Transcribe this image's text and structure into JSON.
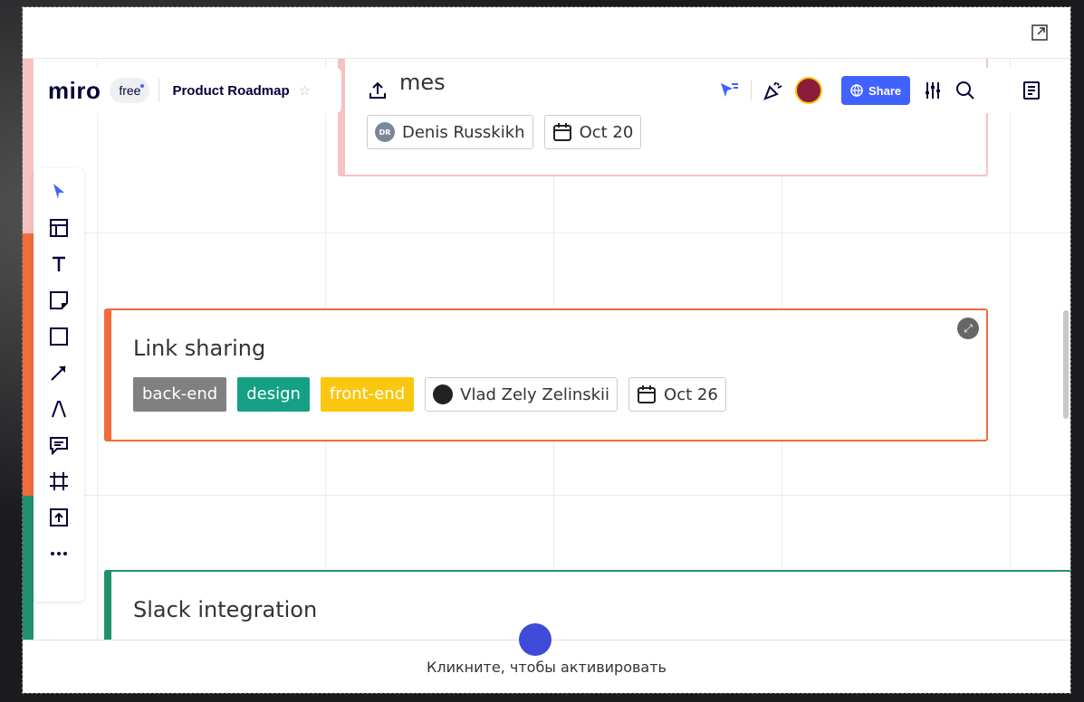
{
  "app": {
    "logo": "miro",
    "plan_badge": "free",
    "board_name": "Product Roadmap",
    "share_label": "Share"
  },
  "cards": [
    {
      "title_partial": "mes",
      "assignee": "Denis Russkikh",
      "assignee_initials": "DR",
      "date": "Oct 20",
      "color": "#f7c2c2"
    },
    {
      "title": "Link sharing",
      "tags": [
        {
          "label": "back-end",
          "color": "#808080"
        },
        {
          "label": "design",
          "color": "#14a085"
        },
        {
          "label": "front-end",
          "color": "#fac710"
        }
      ],
      "assignee": "Vlad Zely Zelinskii",
      "date": "Oct 26",
      "color": "#f26b3a"
    },
    {
      "title": "Slack integration",
      "color": "#21916d"
    }
  ],
  "footer": {
    "activate_text": "Кликните, чтобы активировать"
  },
  "colors": {
    "accent": "#4262ff",
    "lane_red": "#f7c2c2",
    "lane_orange": "#f26b3a",
    "lane_green": "#21916d"
  },
  "toolbar_icons": [
    "select-icon",
    "templates-icon",
    "text-icon",
    "sticky-note-icon",
    "shape-icon",
    "arrow-icon",
    "pen-icon",
    "comment-icon",
    "frame-icon",
    "upload-icon",
    "more-icon"
  ]
}
